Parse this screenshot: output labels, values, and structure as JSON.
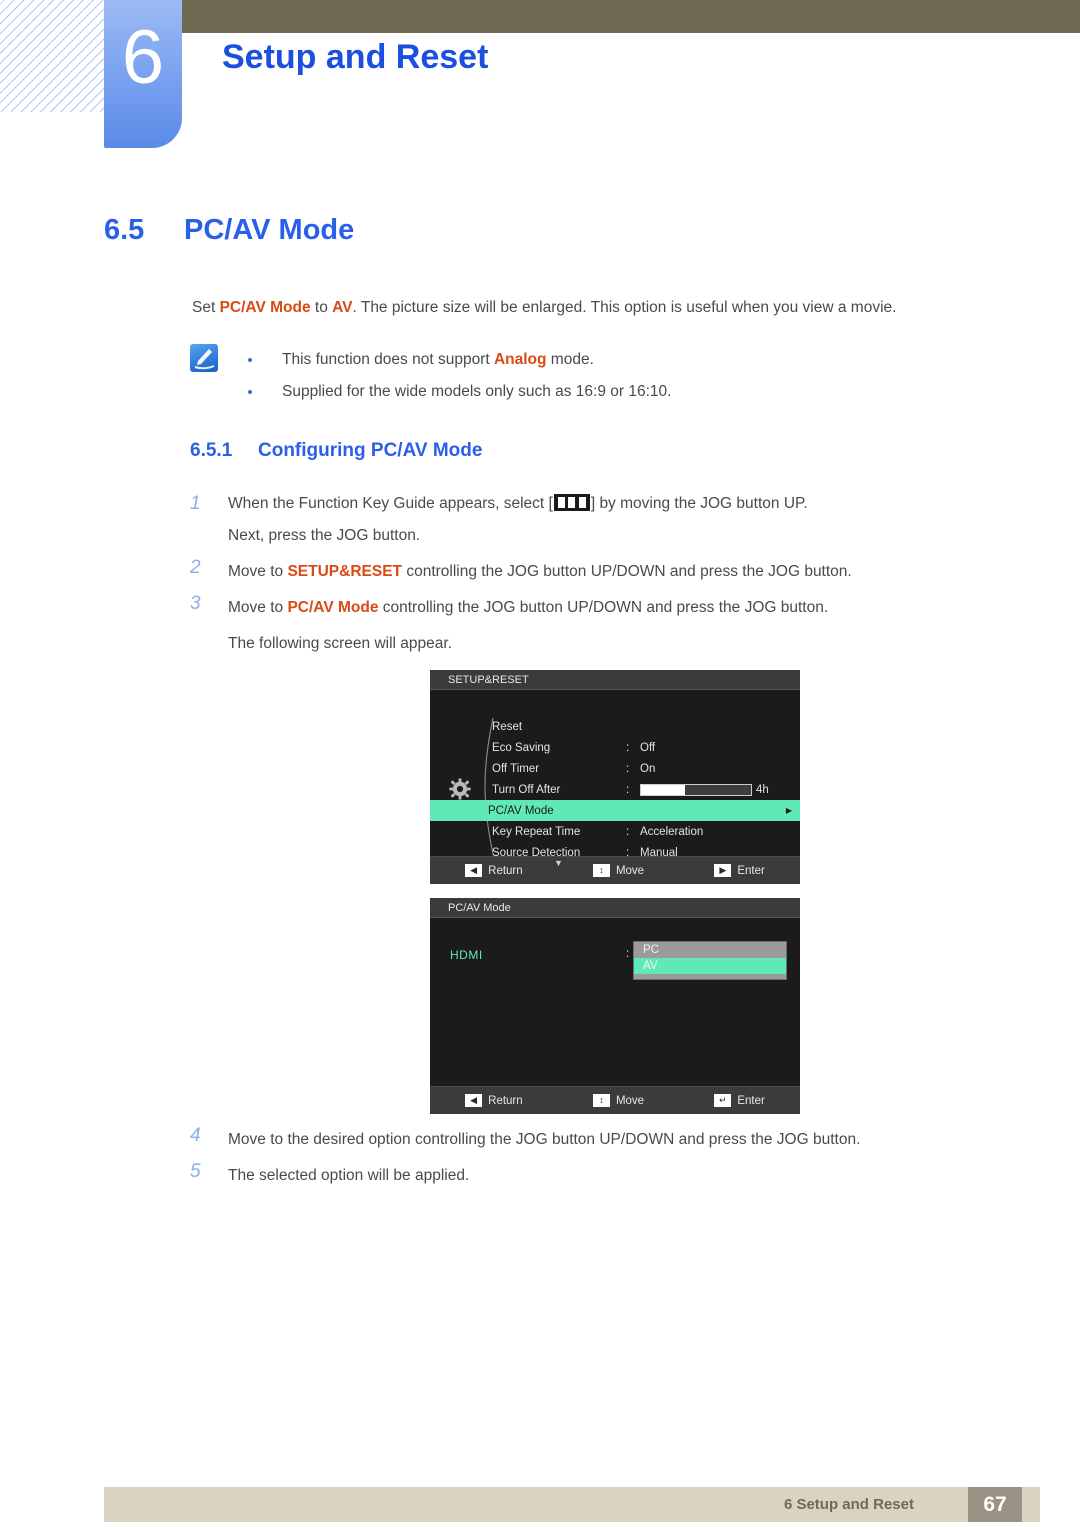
{
  "chapter": {
    "number": "6",
    "title": "Setup and Reset"
  },
  "section": {
    "number": "6.5",
    "title": "PC/AV Mode"
  },
  "intro": {
    "part1": "Set ",
    "kw1": "PC/AV Mode",
    "part2": " to ",
    "kw2": "AV",
    "part3": ". The picture size will be enlarged. This option is useful when you view a movie."
  },
  "notes": [
    {
      "part1": "This function does not support ",
      "kw": "Analog",
      "part2": " mode."
    },
    {
      "part1": "Supplied for the wide models only such as 16:9 or 16:10.",
      "kw": "",
      "part2": ""
    }
  ],
  "subsection": {
    "number": "6.5.1",
    "title": "Configuring PC/AV Mode"
  },
  "steps_top": [
    {
      "num": "1",
      "line_a_pre": "When the Function Key Guide appears, select [",
      "line_a_post": "] by moving the JOG button UP.",
      "line_b": "Next, press the JOG button."
    },
    {
      "num": "2",
      "pre": "Move to ",
      "kw": "SETUP&RESET",
      "post": " controlling the JOG button UP/DOWN and press the JOG button.",
      "line_b": ""
    },
    {
      "num": "3",
      "pre": "Move to ",
      "kw": "PC/AV Mode",
      "post": " controlling the JOG button UP/DOWN and press the JOG button.",
      "line_b": "The following screen will appear."
    }
  ],
  "steps_bottom": [
    {
      "num": "4",
      "text": "Move to the desired option controlling the JOG button UP/DOWN and press the JOG button."
    },
    {
      "num": "5",
      "text": "The selected option will be applied."
    }
  ],
  "osd_setup": {
    "title": "SETUP&RESET",
    "rows": [
      {
        "label": "Reset",
        "colon": "",
        "value": "",
        "type": "plain"
      },
      {
        "label": "Eco Saving",
        "colon": ":",
        "value": "Off",
        "type": "plain"
      },
      {
        "label": "Off Timer",
        "colon": ":",
        "value": "On",
        "type": "plain"
      },
      {
        "label": "Turn Off After",
        "colon": ":",
        "value": "4h",
        "type": "slider",
        "fill_percent": 40
      },
      {
        "label": "PC/AV Mode",
        "colon": "",
        "value": "",
        "type": "highlight",
        "arrow": "▶"
      },
      {
        "label": "Key Repeat Time",
        "colon": ":",
        "value": "Acceleration",
        "type": "plain"
      },
      {
        "label": "Source Detection",
        "colon": ":",
        "value": "Manual",
        "type": "plain"
      }
    ],
    "scroll_caret": "▼",
    "footer": [
      {
        "glyph": "◀",
        "label": "Return"
      },
      {
        "glyph": "↕",
        "label": "Move"
      },
      {
        "glyph": "▶",
        "label": "Enter"
      }
    ]
  },
  "osd_pcav": {
    "title": "PC/AV Mode",
    "source_label": "HDMI",
    "colon": ":",
    "options": [
      {
        "label": "PC",
        "selected": false
      },
      {
        "label": "AV",
        "selected": true
      }
    ],
    "footer": [
      {
        "glyph": "◀",
        "label": "Return"
      },
      {
        "glyph": "↕",
        "label": "Move"
      },
      {
        "glyph": "↵",
        "label": "Enter"
      }
    ]
  },
  "footer": {
    "text": "6 Setup and Reset",
    "page": "67"
  },
  "colors": {
    "heading_blue": "#2a5fe8",
    "keyword_orange": "#d94a15",
    "osd_highlight": "#5fe9b4",
    "header_bar": "#6e6a52",
    "footer_bar": "#d9d4c2",
    "page_box": "#9b9184"
  }
}
